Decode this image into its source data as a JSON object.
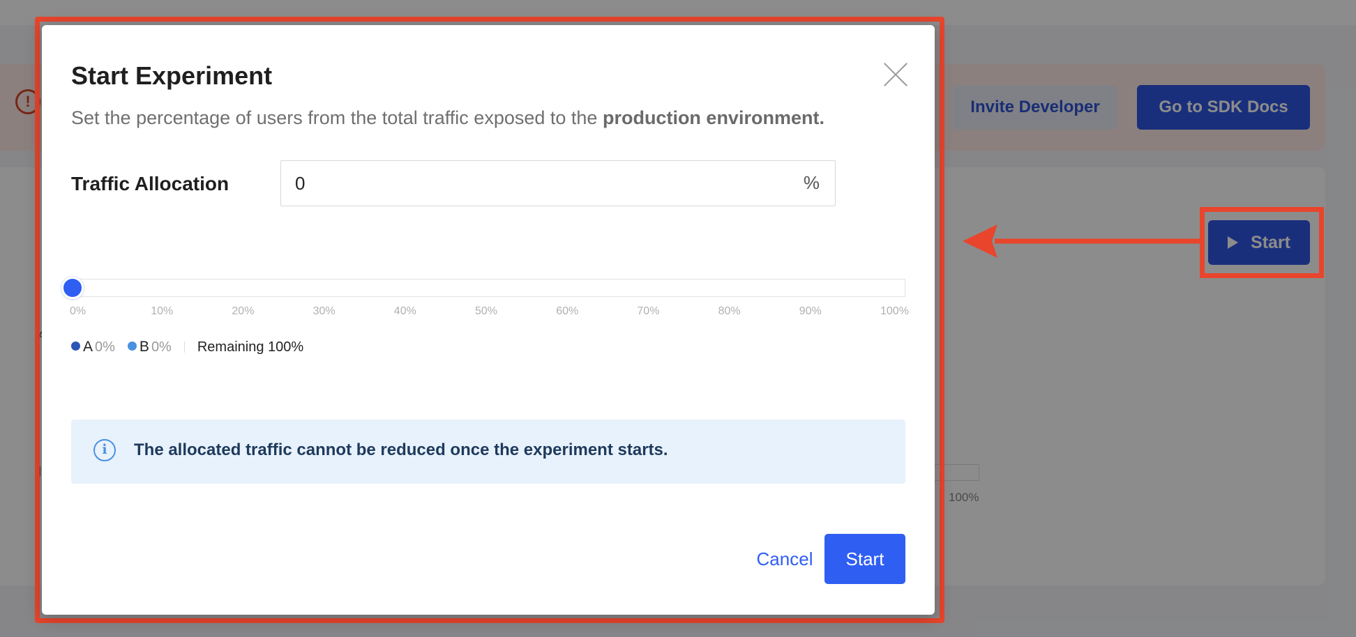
{
  "background": {
    "topbar_text": "",
    "topbar_link": "",
    "invite_button": "Invite Developer",
    "sdk_button": "Go to SDK Docs",
    "start_button": "Start",
    "mini_bar_label": "100%"
  },
  "modal": {
    "title": "Start Experiment",
    "description_prefix": "Set the percentage of users from the total traffic exposed to the ",
    "description_bold": "production environment.",
    "traffic_label": "Traffic Allocation",
    "traffic_value": "0",
    "traffic_unit": "%",
    "slider": {
      "value_percent": 0,
      "ticks": [
        "0%",
        "10%",
        "20%",
        "30%",
        "40%",
        "50%",
        "60%",
        "70%",
        "80%",
        "90%",
        "100%"
      ]
    },
    "legend": {
      "a_label": "A",
      "a_value": "0%",
      "b_label": "B",
      "b_value": "0%",
      "remaining": "Remaining 100%"
    },
    "info_text": "The allocated traffic cannot be reduced once the experiment starts.",
    "cancel_label": "Cancel",
    "start_label": "Start"
  },
  "colors": {
    "primary": "#2f5ef2",
    "annotation": "#e8452c",
    "legend_a": "#2c55b8",
    "legend_b": "#4a90e2",
    "info_bg": "#e8f2fc"
  },
  "icons": {
    "close": "close-icon",
    "info": "info-icon",
    "play": "play-icon",
    "alert": "alert-icon"
  }
}
